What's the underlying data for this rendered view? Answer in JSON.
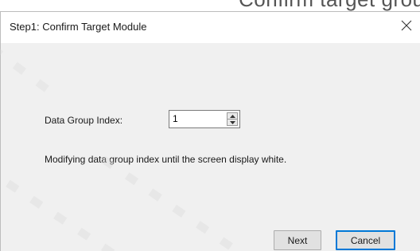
{
  "header": {
    "cropped_text": "Confirm target group"
  },
  "dialog": {
    "title": "Step1: Confirm Target Module",
    "close_glyph": "×"
  },
  "form": {
    "index_label": "Data Group Index:",
    "index_value": "1",
    "instruction": "Modifying data group index until the screen display white."
  },
  "buttons": {
    "next": "Next",
    "cancel": "Cancel"
  },
  "colors": {
    "dialog_bg": "#f0f0f0",
    "title_bg": "#ffffff",
    "focus_accent": "#0078d7"
  },
  "icons": {
    "close": "close-icon",
    "spin_up": "spin-up-arrow-icon",
    "spin_down": "spin-down-arrow-icon"
  }
}
